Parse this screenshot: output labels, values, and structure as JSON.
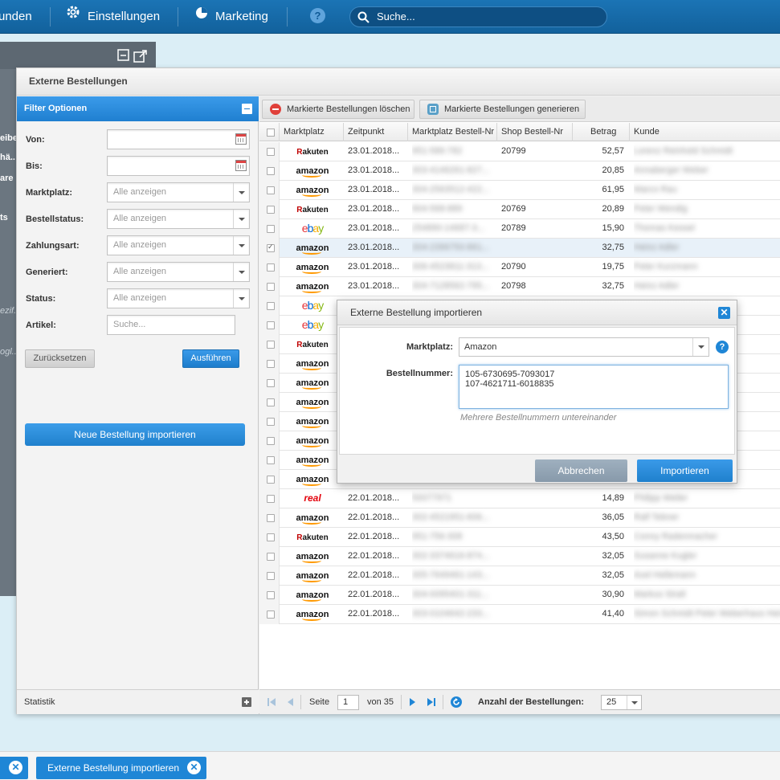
{
  "topnav": {
    "items": [
      {
        "label": "unden",
        "icon": ""
      },
      {
        "label": "Einstellungen",
        "icon": "gear-icon"
      },
      {
        "label": "Marketing",
        "icon": "pie-chart-icon"
      },
      {
        "label": "",
        "icon": "help-icon",
        "glyph": "?"
      }
    ],
    "search_placeholder": "Suche..."
  },
  "background": {
    "side_texts": [
      "eibe",
      "hä..",
      "are",
      "ts",
      "ezif..",
      "ogl.."
    ]
  },
  "window": {
    "title": "Externe Bestellungen"
  },
  "filter": {
    "header": "Filter Optionen",
    "fields": [
      {
        "label": "Von:",
        "type": "date",
        "value": ""
      },
      {
        "label": "Bis:",
        "type": "date",
        "value": ""
      },
      {
        "label": "Marktplatz:",
        "type": "select",
        "value": "Alle anzeigen"
      },
      {
        "label": "Bestellstatus:",
        "type": "select",
        "value": "Alle anzeigen"
      },
      {
        "label": "Zahlungsart:",
        "type": "select",
        "value": "Alle anzeigen"
      },
      {
        "label": "Generiert:",
        "type": "select",
        "value": "Alle anzeigen"
      },
      {
        "label": "Status:",
        "type": "select",
        "value": "Alle anzeigen"
      },
      {
        "label": "Artikel:",
        "type": "text",
        "placeholder": "Suche..."
      }
    ],
    "reset_label": "Zurücksetzen",
    "run_label": "Ausführen",
    "import_label": "Neue Bestellung importieren",
    "statistik_label": "Statistik"
  },
  "toolbar": {
    "delete_label": "Markierte Bestellungen löschen",
    "generate_label": "Markierte Bestellungen generieren"
  },
  "table": {
    "columns": [
      "Marktplatz",
      "Zeitpunkt",
      "Marktplatz Bestell-Nr",
      "Shop Bestell-Nr",
      "Betrag",
      "Kunde"
    ],
    "rows": [
      {
        "marketplace": "rakuten",
        "time": "23.01.2018...",
        "mp_no": "951-586-782",
        "shop_no": "20799",
        "amount": "52,57",
        "customer": "Lorenz Reinhold Schmidt",
        "checked": false
      },
      {
        "marketplace": "amazon",
        "time": "23.01.2018...",
        "mp_no": "303-4146261-827...",
        "shop_no": "",
        "amount": "20,85",
        "customer": "Annaberger Weber",
        "checked": false
      },
      {
        "marketplace": "amazon",
        "time": "23.01.2018...",
        "mp_no": "304-2563512-422...",
        "shop_no": "",
        "amount": "61,95",
        "customer": "Marco Rau",
        "checked": false
      },
      {
        "marketplace": "rakuten",
        "time": "23.01.2018...",
        "mp_no": "904-568-889",
        "shop_no": "20769",
        "amount": "20,89",
        "customer": "Peter Wendig",
        "checked": false
      },
      {
        "marketplace": "ebay",
        "time": "23.01.2018...",
        "mp_no": "254890-14687-3...",
        "shop_no": "20789",
        "amount": "15,90",
        "customer": "Thomas Kessel",
        "checked": false
      },
      {
        "marketplace": "amazon",
        "time": "23.01.2018...",
        "mp_no": "304-2396750-861...",
        "shop_no": "",
        "amount": "32,75",
        "customer": "Heinz Adler",
        "checked": true
      },
      {
        "marketplace": "amazon",
        "time": "23.01.2018...",
        "mp_no": "306-4523811-313...",
        "shop_no": "20790",
        "amount": "19,75",
        "customer": "Peter Kurzmann",
        "checked": false
      },
      {
        "marketplace": "amazon",
        "time": "23.01.2018...",
        "mp_no": "304-7128562-795...",
        "shop_no": "20798",
        "amount": "32,75",
        "customer": "Heinz Adler",
        "checked": false
      },
      {
        "marketplace": "ebay",
        "time": "",
        "mp_no": "",
        "shop_no": "",
        "amount": "",
        "customer": "",
        "checked": false
      },
      {
        "marketplace": "ebay",
        "time": "",
        "mp_no": "",
        "shop_no": "",
        "amount": "",
        "customer": "",
        "checked": false
      },
      {
        "marketplace": "rakuten",
        "time": "",
        "mp_no": "",
        "shop_no": "",
        "amount": "",
        "customer": "",
        "checked": false
      },
      {
        "marketplace": "amazon",
        "time": "",
        "mp_no": "",
        "shop_no": "",
        "amount": "",
        "customer": "",
        "checked": false
      },
      {
        "marketplace": "amazon",
        "time": "",
        "mp_no": "",
        "shop_no": "",
        "amount": "",
        "customer": "",
        "checked": false
      },
      {
        "marketplace": "amazon",
        "time": "",
        "mp_no": "",
        "shop_no": "",
        "amount": "",
        "customer": "",
        "checked": false
      },
      {
        "marketplace": "amazon",
        "time": "",
        "mp_no": "",
        "shop_no": "",
        "amount": "",
        "customer": "",
        "checked": false
      },
      {
        "marketplace": "amazon",
        "time": "",
        "mp_no": "",
        "shop_no": "",
        "amount": "",
        "customer": "",
        "checked": false
      },
      {
        "marketplace": "amazon",
        "time": "",
        "mp_no": "",
        "shop_no": "",
        "amount": "",
        "customer": "",
        "checked": false
      },
      {
        "marketplace": "amazon",
        "time": "",
        "mp_no": "",
        "shop_no": "",
        "amount": "",
        "customer": "",
        "checked": false
      },
      {
        "marketplace": "real",
        "time": "22.01.2018...",
        "mp_no": "50077971",
        "shop_no": "",
        "amount": "14,89",
        "customer": "Philipp Weiler",
        "checked": false
      },
      {
        "marketplace": "amazon",
        "time": "22.01.2018...",
        "mp_no": "302-4521951-606...",
        "shop_no": "",
        "amount": "36,05",
        "customer": "Ralf Tebner",
        "checked": false
      },
      {
        "marketplace": "rakuten",
        "time": "22.01.2018...",
        "mp_no": "951-756-308",
        "shop_no": "",
        "amount": "43,50",
        "customer": "Conny Radenmacher",
        "checked": false
      },
      {
        "marketplace": "amazon",
        "time": "22.01.2018...",
        "mp_no": "302-3374616-874...",
        "shop_no": "",
        "amount": "32,05",
        "customer": "Susanne Kugler",
        "checked": false
      },
      {
        "marketplace": "amazon",
        "time": "22.01.2018...",
        "mp_no": "305-7649461-143...",
        "shop_no": "",
        "amount": "32,05",
        "customer": "Axel Hellemann",
        "checked": false
      },
      {
        "marketplace": "amazon",
        "time": "22.01.2018...",
        "mp_no": "304-0095401-311...",
        "shop_no": "",
        "amount": "30,90",
        "customer": "Markus Strall",
        "checked": false
      },
      {
        "marketplace": "amazon",
        "time": "22.01.2018...",
        "mp_no": "303-0104642-233...",
        "shop_no": "",
        "amount": "41,40",
        "customer": "Simon Schmidt Peter Weberhaus Hein",
        "checked": false
      }
    ]
  },
  "logos": {
    "amazon": "amazon",
    "rakuten_mark": "R",
    "rakuten_text": "akuten",
    "ebay": [
      "e",
      "b",
      "a",
      "y"
    ],
    "real": "real"
  },
  "pager": {
    "page_label": "Seite",
    "page_value": "1",
    "of_label": "von 35",
    "count_label": "Anzahl der Bestellungen:",
    "page_size": "25"
  },
  "modal": {
    "title": "Externe Bestellung importieren",
    "marketplace_label": "Marktplatz:",
    "marketplace_value": "Amazon",
    "order_label": "Bestellnummer:",
    "order_lines": [
      "105-6730695-7093017",
      "107-4621711-6018835"
    ],
    "hint": "Mehrere Bestellnummern untereinander",
    "cancel_label": "Abbrechen",
    "import_label": "Importieren",
    "close_glyph": "✕",
    "help_glyph": "?"
  },
  "taskbar": {
    "tabs": [
      {
        "label": "",
        "close": "✕"
      },
      {
        "label": "Externe Bestellung importieren",
        "close": "✕"
      }
    ]
  },
  "colors": {
    "nav": "#1b74b5",
    "accent": "#1f86d6",
    "delete_icon": "#e0403a",
    "generate_icon": "#5aa0c8"
  }
}
